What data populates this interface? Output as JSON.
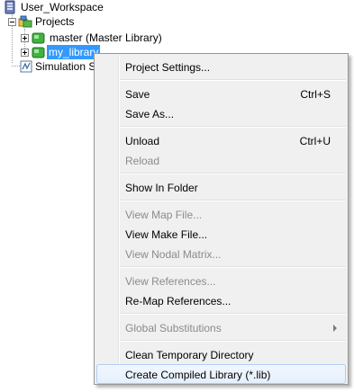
{
  "tree": {
    "workspace": {
      "label": "User_Workspace",
      "icon": "workspace-icon"
    },
    "projects": {
      "label": "Projects",
      "icon": "projects-folder-icon"
    },
    "master": {
      "label": "master (Master Library)",
      "icon": "library-icon"
    },
    "my_library": {
      "label": "my_library",
      "icon": "library-icon"
    },
    "simulation": {
      "label": "Simulation S",
      "icon": "simulation-icon"
    }
  },
  "colors": {
    "selection": "#3399ff",
    "menu_bg": "#f0f0f0",
    "hover_border": "#aecff7",
    "disabled_text": "#8b8b8b"
  },
  "menu": {
    "project_settings": {
      "label": "Project Settings..."
    },
    "save": {
      "label": "Save",
      "shortcut": "Ctrl+S"
    },
    "save_as": {
      "label": "Save As..."
    },
    "unload": {
      "label": "Unload",
      "shortcut": "Ctrl+U"
    },
    "reload": {
      "label": "Reload"
    },
    "show_in_folder": {
      "label": "Show In Folder"
    },
    "view_map_file": {
      "label": "View Map File..."
    },
    "view_make_file": {
      "label": "View Make File..."
    },
    "view_nodal_matrix": {
      "label": "View Nodal Matrix..."
    },
    "view_references": {
      "label": "View References..."
    },
    "remap_references": {
      "label": "Re-Map References..."
    },
    "global_substitutions": {
      "label": "Global Substitutions",
      "icon": "submenu-arrow-icon"
    },
    "clean_temp": {
      "label": "Clean Temporary Directory"
    },
    "create_compiled_library": {
      "label": "Create Compiled Library (*.lib)"
    }
  }
}
